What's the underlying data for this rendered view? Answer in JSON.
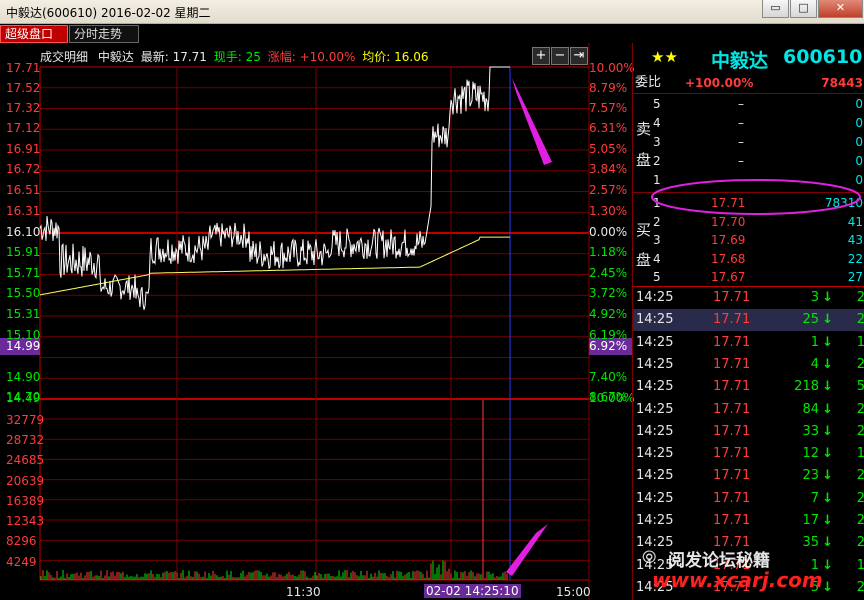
{
  "window": {
    "title": "中毅达(600610) 2016-02-02 星期二",
    "min": "▭",
    "max": "□",
    "close": "✕"
  },
  "tabs": [
    {
      "label": "超级盘口"
    },
    {
      "label": "分时走势"
    }
  ],
  "chart_header": {
    "section": "成交明细",
    "name": "中毅达",
    "latest_label": "最新:",
    "latest": "17.71",
    "hand_label": "现手:",
    "hand": "25",
    "chg_label": "涨幅:",
    "chg": "+10.00%",
    "avg_label": "均价:",
    "avg": "16.06"
  },
  "controls": {
    "plus": "+",
    "minus": "−",
    "fit": "⇥"
  },
  "price_labels": [
    "17.71",
    "17.52",
    "17.32",
    "17.12",
    "16.91",
    "16.72",
    "16.51",
    "16.31",
    "16.10",
    "15.91",
    "15.71",
    "15.50",
    "15.31",
    "15.10",
    "14.99",
    "14.90",
    "14.70",
    "14.49"
  ],
  "pct_labels": [
    "10.00%",
    "8.79%",
    "7.57%",
    "6.31%",
    "5.05%",
    "3.84%",
    "2.57%",
    "1.30%",
    "0.00%",
    "1.18%",
    "2.45%",
    "3.72%",
    "4.92%",
    "6.19%",
    "6.92%",
    "7.40%",
    "8.67%",
    "10.00%"
  ],
  "volume_labels": [
    "32779",
    "28732",
    "24685",
    "20639",
    "16389",
    "12343",
    "8296",
    "4249"
  ],
  "time_labels": {
    "t1130": "11:30",
    "cursor": "02-02 14:25:10",
    "t1500": "15:00"
  },
  "stock": {
    "stars": "★★",
    "name": "中毅达",
    "code": "600610"
  },
  "order_ratio": {
    "label": "委比",
    "value": "+100.00%",
    "diff": "78443"
  },
  "sell_side_label": [
    "卖",
    "盘"
  ],
  "buy_side_label": [
    "买",
    "盘"
  ],
  "sell_orders": [
    {
      "level": "5",
      "price": "–",
      "vol": "0"
    },
    {
      "level": "4",
      "price": "–",
      "vol": "0"
    },
    {
      "level": "3",
      "price": "–",
      "vol": "0"
    },
    {
      "level": "2",
      "price": "–",
      "vol": "0"
    },
    {
      "level": "1",
      "price": "–",
      "vol": "0"
    }
  ],
  "buy_orders": [
    {
      "level": "1",
      "price": "17.71",
      "vol": "78310"
    },
    {
      "level": "2",
      "price": "17.70",
      "vol": "41"
    },
    {
      "level": "3",
      "price": "17.69",
      "vol": "43"
    },
    {
      "level": "4",
      "price": "17.68",
      "vol": "22"
    },
    {
      "level": "5",
      "price": "17.67",
      "vol": "27"
    }
  ],
  "trades": [
    {
      "time": "14:25",
      "price": "17.71",
      "vol": "3",
      "n": "2"
    },
    {
      "time": "14:25",
      "price": "17.71",
      "vol": "25",
      "n": "2"
    },
    {
      "time": "14:25",
      "price": "17.71",
      "vol": "1",
      "n": "1"
    },
    {
      "time": "14:25",
      "price": "17.71",
      "vol": "4",
      "n": "2"
    },
    {
      "time": "14:25",
      "price": "17.71",
      "vol": "218",
      "n": "5"
    },
    {
      "time": "14:25",
      "price": "17.71",
      "vol": "84",
      "n": "2"
    },
    {
      "time": "14:25",
      "price": "17.71",
      "vol": "33",
      "n": "2"
    },
    {
      "time": "14:25",
      "price": "17.71",
      "vol": "12",
      "n": "1"
    },
    {
      "time": "14:25",
      "price": "17.71",
      "vol": "23",
      "n": "2"
    },
    {
      "time": "14:25",
      "price": "17.71",
      "vol": "7",
      "n": "2"
    },
    {
      "time": "14:25",
      "price": "17.71",
      "vol": "17",
      "n": "2"
    },
    {
      "time": "14:25",
      "price": "17.71",
      "vol": "35",
      "n": "2"
    },
    {
      "time": "14:25",
      "price": "17.71",
      "vol": "1",
      "n": "1"
    },
    {
      "time": "14:25",
      "price": "17.71",
      "vol": "5",
      "n": "2"
    }
  ],
  "watermark": {
    "line1": "阅发论坛秘籍",
    "line2": "www.xcarj.com"
  },
  "colors": {
    "up": "#ff3b3b",
    "down": "#00e600",
    "avg": "#ffff66",
    "annotation": "#e020e0"
  },
  "icons": {
    "down_arrow": "down-arrow-icon",
    "wechat": "wechat-icon"
  }
}
